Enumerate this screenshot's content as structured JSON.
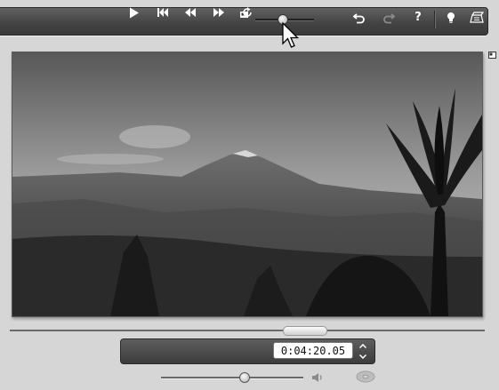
{
  "toolbar": {
    "zoom_level": 0.45,
    "icons": [
      "thumbnail-size-icon",
      "undo-icon",
      "redo-icon",
      "help-icon",
      "lightbulb-icon",
      "export-icon"
    ],
    "help_label": "?"
  },
  "preview": {
    "scene": "mountain-landscape-with-palm-tree",
    "side_icon": "thumbnail-icon"
  },
  "scrubber": {
    "position": 0.62
  },
  "transport": {
    "buttons": [
      "play-icon",
      "go-to-start-icon",
      "rewind-icon",
      "fast-forward-icon",
      "loop-icon"
    ],
    "timecode": "0:04:20.05"
  },
  "volume": {
    "level": 0.58
  }
}
